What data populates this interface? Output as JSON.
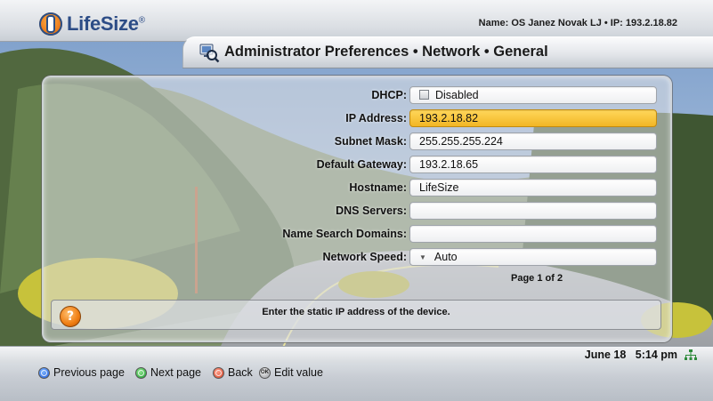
{
  "header": {
    "logo_text": "LifeSize",
    "logo_mark": "®",
    "user_info": "Name: OS Janez Novak LJ • IP: 193.2.18.82"
  },
  "title": {
    "icon": "network-settings-icon",
    "text": "Administrator Preferences • Network • General"
  },
  "form": {
    "fields": [
      {
        "label": "DHCP:",
        "value": "Disabled",
        "kind": "checkbox"
      },
      {
        "label": "IP Address:",
        "value": "193.2.18.82",
        "kind": "text",
        "selected": true
      },
      {
        "label": "Subnet Mask:",
        "value": "255.255.255.224",
        "kind": "text"
      },
      {
        "label": "Default Gateway:",
        "value": "193.2.18.65",
        "kind": "text"
      },
      {
        "label": "Hostname:",
        "value": "LifeSize",
        "kind": "text"
      },
      {
        "label": "DNS Servers:",
        "value": "",
        "kind": "text"
      },
      {
        "label": "Name Search Domains:",
        "value": "",
        "kind": "text"
      },
      {
        "label": "Network Speed:",
        "value": "Auto",
        "kind": "dropdown"
      }
    ],
    "page_info": "Page 1 of 2"
  },
  "help": {
    "icon_glyph": "?",
    "text": "Enter the static IP address of the device."
  },
  "status": {
    "date": "June 18",
    "time": "5:14 pm"
  },
  "nav": {
    "previous_page": "Previous page",
    "next_page": "Next page",
    "back": "Back",
    "edit_value": "Edit value",
    "edit_key_glyph": "OK"
  },
  "colors": {
    "selected_field": "#f2b624",
    "logo_blue": "#2c4c86",
    "logo_orange": "#e9791a"
  }
}
